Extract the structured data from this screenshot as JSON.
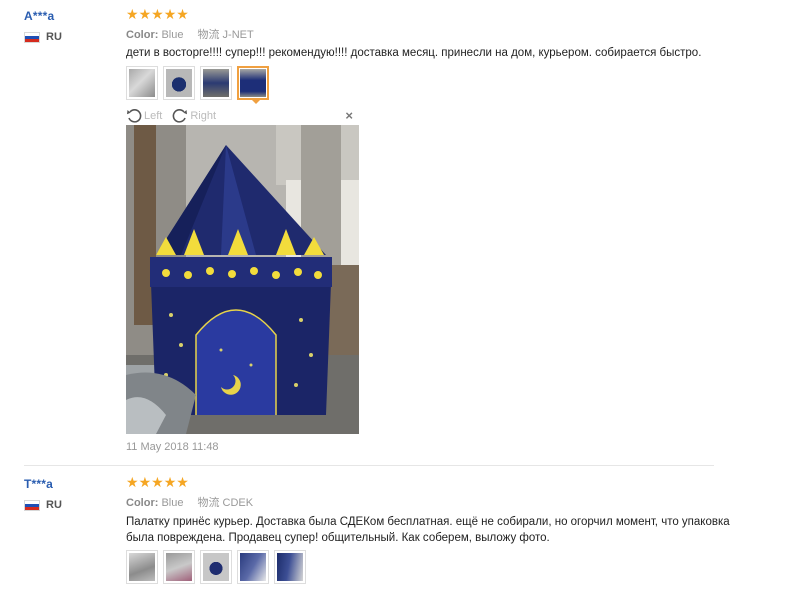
{
  "reviews": [
    {
      "user": "A***a",
      "country": "RU",
      "rating": 5,
      "color_label": "Color:",
      "color_value": "Blue",
      "shipping": "物流 J-NET",
      "text": "дети в восторге!!!! супер!!! рекомендую!!!! доставка месяц. принесли на дом, курьером. собирается быстро.",
      "thumbnails": 4,
      "active_thumbnail": 4,
      "viewer": {
        "left_label": "Left",
        "right_label": "Right",
        "close": "×"
      },
      "date": "11 May 2018 11:48"
    },
    {
      "user": "T***a",
      "country": "RU",
      "rating": 5,
      "color_label": "Color:",
      "color_value": "Blue",
      "shipping": "物流 CDEK",
      "text": "Палатку принёс курьер. Доставка была СДЕКом бесплатная. ещё не собирали, но огорчил момент, что упаковка была повреждена. Продавец супер! общительный. Как соберем, выложу фото.",
      "thumbnails": 5
    }
  ],
  "colors": {
    "username": "#2a5db0",
    "star": "#f5a623",
    "active_thumb_border": "#f0a040",
    "flag_white": "#ffffff",
    "flag_blue": "#1f4fb5",
    "flag_red": "#d52b1e"
  }
}
